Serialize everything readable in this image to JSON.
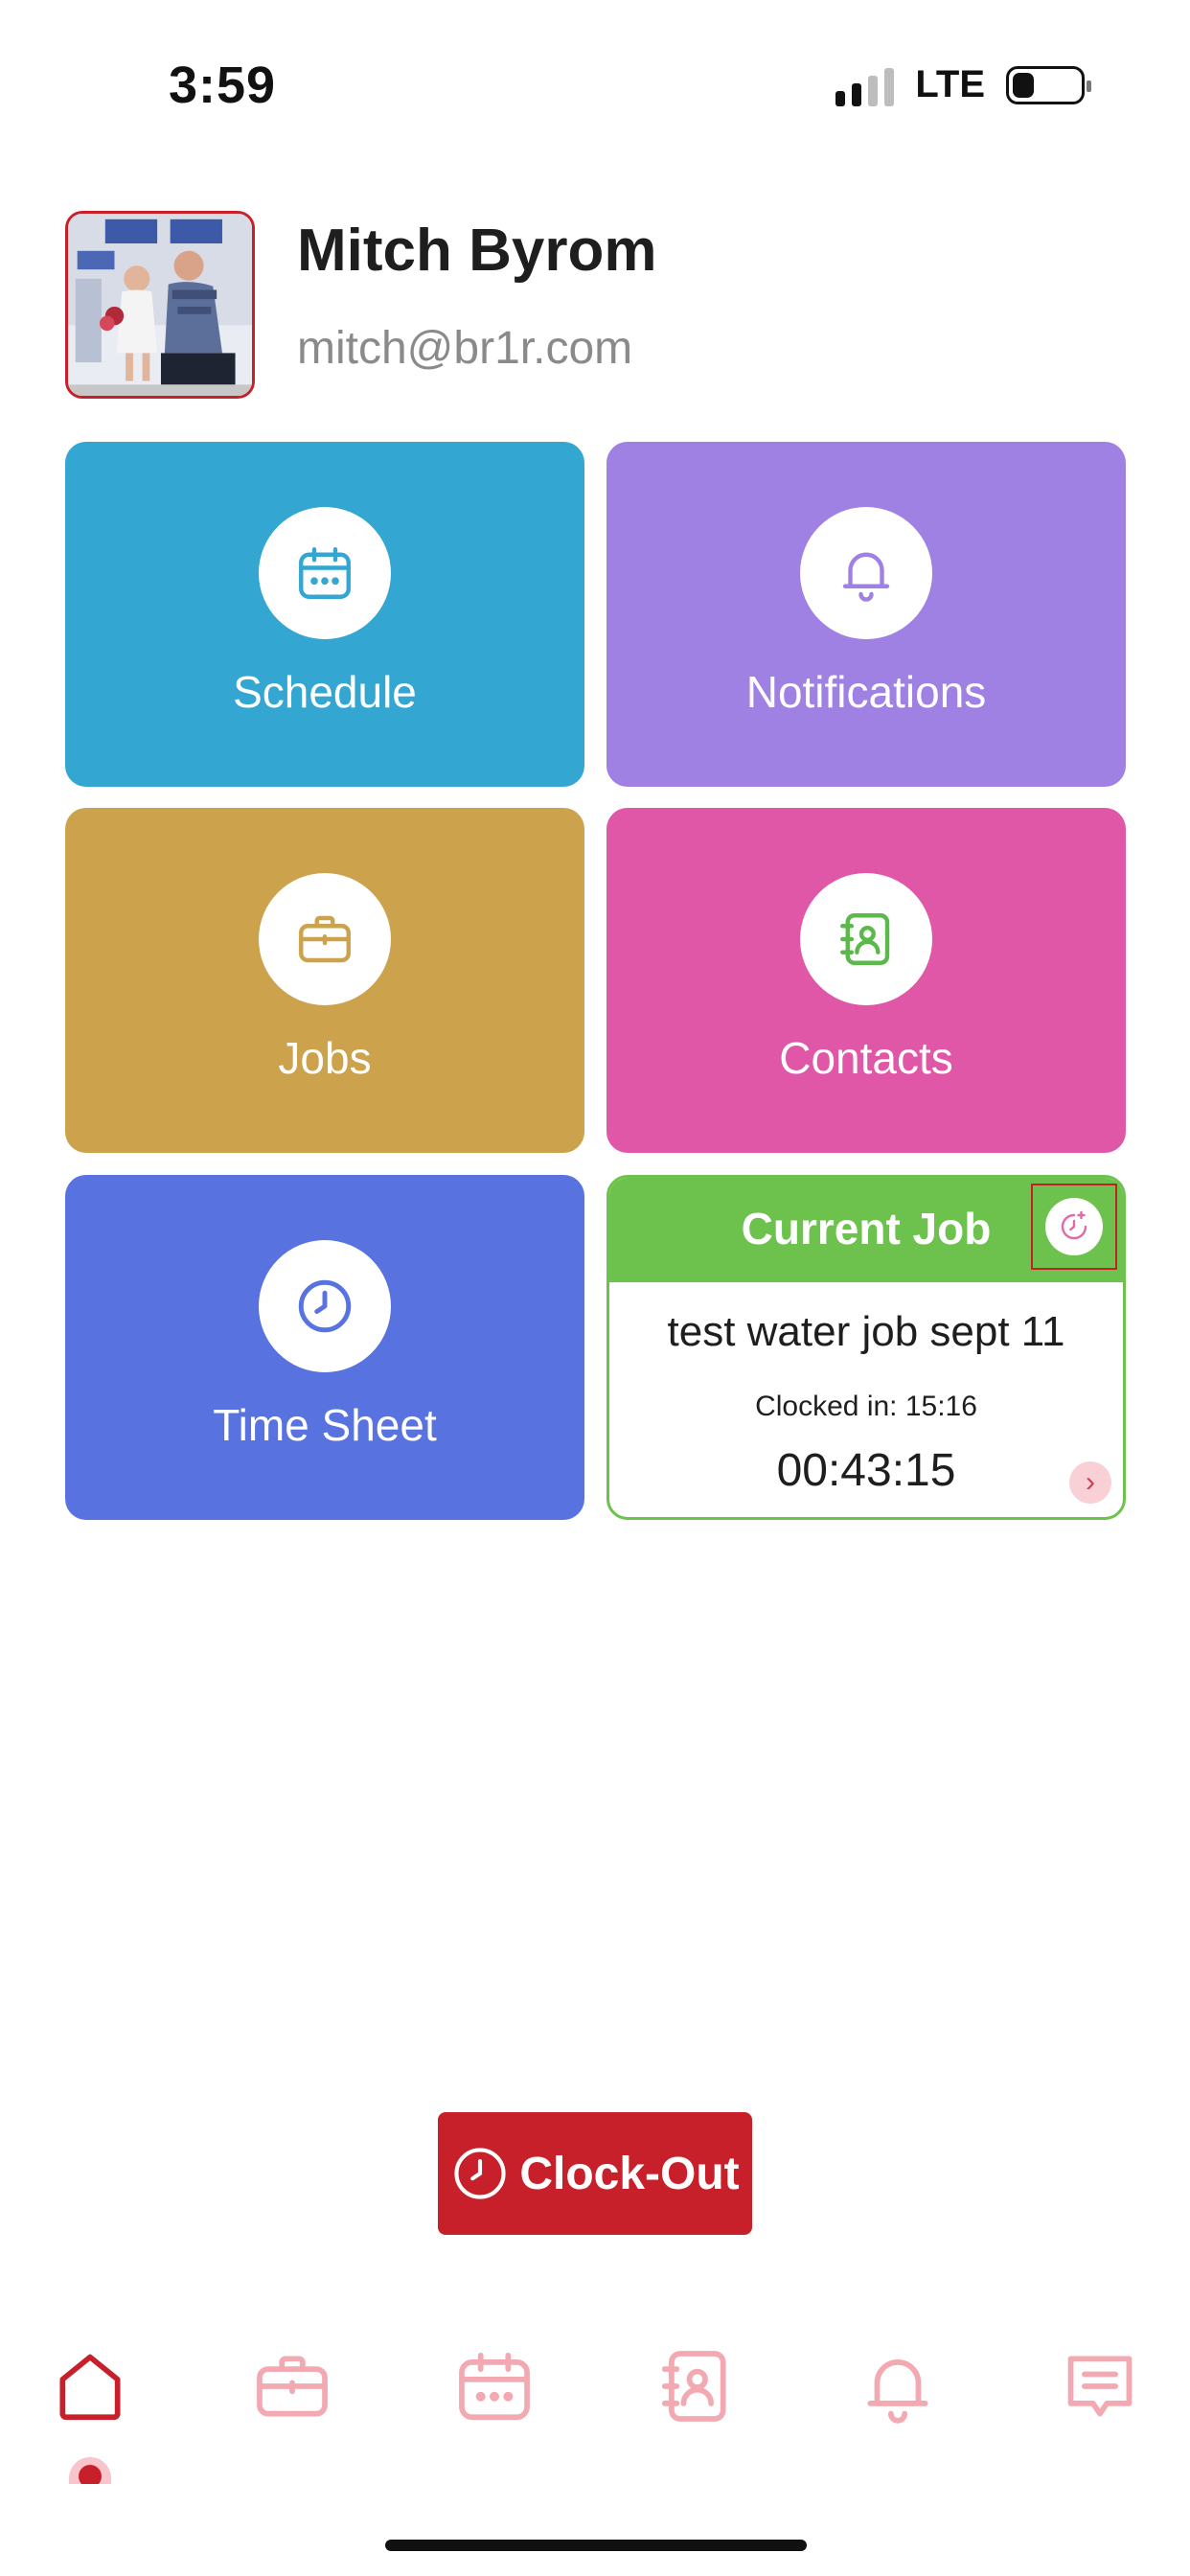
{
  "status_bar": {
    "time": "3:59",
    "network": "LTE"
  },
  "profile": {
    "name": "Mitch Byrom",
    "email": "mitch@br1r.com"
  },
  "tiles": [
    {
      "label": "Schedule",
      "icon": "calendar-icon",
      "color": "#33a6d2"
    },
    {
      "label": "Notifications",
      "icon": "bell-icon",
      "color": "#9f80e3"
    },
    {
      "label": "Jobs",
      "icon": "briefcase-icon",
      "color": "#cca24c"
    },
    {
      "label": "Contacts",
      "icon": "contact-book-icon",
      "color": "#df57a6"
    },
    {
      "label": "Time Sheet",
      "icon": "clock-icon",
      "color": "#5873df"
    }
  ],
  "current_job": {
    "title": "Current Job",
    "job_name": "test water job sept 11",
    "clocked_in": "Clocked in: 15:16",
    "elapsed": "00:43:15",
    "header_color": "#6cc24d"
  },
  "clock_out": {
    "label": "Clock-Out",
    "color": "#c8202b"
  },
  "bottom_nav": {
    "items": [
      "home-icon",
      "briefcase-icon",
      "calendar-icon",
      "contact-book-icon",
      "bell-icon",
      "message-icon"
    ],
    "active": "home-icon",
    "active_color": "#c8202b",
    "inactive_color": "#f2a9b1"
  }
}
